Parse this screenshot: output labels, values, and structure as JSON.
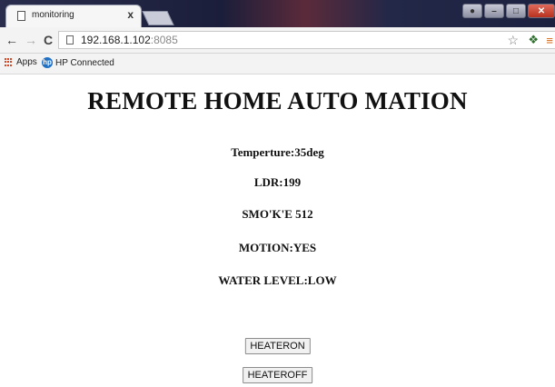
{
  "browser": {
    "tab_title": "monitoring",
    "tab_close": "x",
    "url_host": "192.168.1.102",
    "url_port": ":8085",
    "bookmarks": [
      {
        "label": "Apps",
        "icon": "apps-grid-icon"
      },
      {
        "label": "HP Connected",
        "icon": "hp-logo-icon"
      }
    ],
    "icons": {
      "back": "back-arrow-icon",
      "forward": "forward-arrow-icon",
      "reload": "reload-icon",
      "star": "star-icon",
      "menu": "menu-icon"
    }
  },
  "page": {
    "title": "REMOTE HOME AUTO MATION",
    "readings": [
      "Temperture:35deg",
      "LDR:199",
      "SMO'K'E 512",
      "MOTION:YES",
      "WATER LEVEL:LOW"
    ],
    "buttons": {
      "heater_on": "HEATERON",
      "heater_off": "HEATEROFF"
    }
  }
}
